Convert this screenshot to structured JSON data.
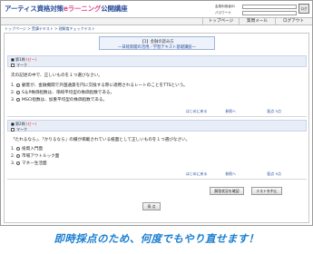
{
  "header": {
    "brand_prefix": "アーティス資格対策",
    "brand_highlight": "eラーニング",
    "brand_suffix": "公開講座",
    "login": {
      "user_label": "会員利用者ID",
      "password_label": "パスワード",
      "login_button": "ログイン"
    }
  },
  "nav": {
    "tabs": [
      {
        "label": "トップページ"
      },
      {
        "label": "質問メール"
      },
      {
        "label": "ログアウト"
      }
    ]
  },
  "breadcrumb": "トップページ > 受講テキスト > 理解度チェックテスト",
  "title": {
    "line1": "【1】金融の読み方",
    "line2": "―日経新聞の活用／学習テキスト基礎講座―"
  },
  "questions": [
    {
      "header": "■ 第1問",
      "warning": "(ゼー)",
      "mark_label": "マーク",
      "text": "次の記述の中で、正しいものを１つ選びなさい。",
      "options": [
        {
          "num": "1.",
          "label": "顧客が、金融機関で外国通貨を円に交換する際に適用されるレートのことをTTSという。"
        },
        {
          "num": "2.",
          "label": "S＆P株価指数は、単純平均型の株価指数である。"
        },
        {
          "num": "3.",
          "label": "MSCI指数は、加重平均型の株価指数である。"
        }
      ],
      "links": {
        "hint": "はじめに戻る",
        "back": "参照へ",
        "score": "配点 5点"
      }
    },
    {
      "header": "■ 第2問",
      "warning": "(ゼー)",
      "mark_label": "マーク",
      "text": "「たれるなら」、「かりるなら」の欄が掲載されている紙面として正しいものを１つ選びなさい。",
      "options": [
        {
          "num": "1.",
          "label": "投資入門面"
        },
        {
          "num": "2.",
          "label": "市場アウトルック面"
        },
        {
          "num": "3.",
          "label": "マネー生活面"
        }
      ],
      "links": {
        "hint": "はじめに戻る",
        "back": "参照へ",
        "score": "配点 5点"
      }
    }
  ],
  "buttons": {
    "check_answer": "解答状況を確認",
    "stop_test": "テストを中止",
    "grade": "採 点"
  },
  "caption": "即時採点のため、何度でもやり直せます！"
}
